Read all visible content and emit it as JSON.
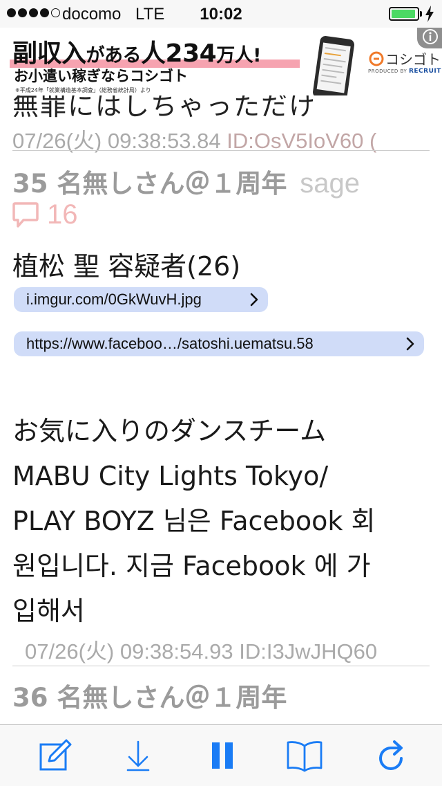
{
  "status_bar": {
    "carrier": "docomo",
    "network": "LTE",
    "time": "10:02",
    "signal_bars_filled": 4,
    "signal_bars_total": 5,
    "battery_level": 0.95,
    "battery_color": "#4cd964"
  },
  "ad": {
    "headline_parts": [
      "副収入",
      "がある",
      "人",
      "234",
      "万人!"
    ],
    "subheadline": "お小遣い稼ぎならコシゴト",
    "footnote": "※平成24年「就業構造基本調査」（総務省統計局）より",
    "brand_name": "コシゴト",
    "produced_by": "PRODUCED BY",
    "produced_company": "RECRUIT",
    "info_icon": "info-icon"
  },
  "thread": {
    "partial_text": "無罪にはしちゃっただけ",
    "post34_meta": {
      "date": "07/26(火) 09:38:53.84",
      "id": "ID:OsV5IoV60 ("
    },
    "post35": {
      "number": "35",
      "name": "名無しさん＠１周年",
      "mail": "sage",
      "reply_count": "16",
      "body_line1": "植松 聖 容疑者(26)",
      "links": [
        {
          "text": "i.imgur.com/0GkWuvH.jpg"
        },
        {
          "text": "https://www.faceboo…/satoshi.uematsu.58"
        }
      ],
      "body_lines": [
        "お気に入りのダンスチーム",
        "MABU City Lights Tokyo/",
        "PLAY BOYZ 님은 Facebook 회",
        "원입니다. 지금 Facebook 에 가",
        "입해서"
      ],
      "meta_date": "07/26(火) 09:38:54.93",
      "meta_id": "ID:I3JwJHQ60"
    },
    "post36": {
      "number": "36",
      "name": "名無しさん＠１周年"
    }
  },
  "toolbar": {
    "icons": [
      "compose-icon",
      "download-icon",
      "pause-icon",
      "bookmarks-icon",
      "refresh-icon"
    ],
    "accent_color": "#1a7cf5"
  }
}
